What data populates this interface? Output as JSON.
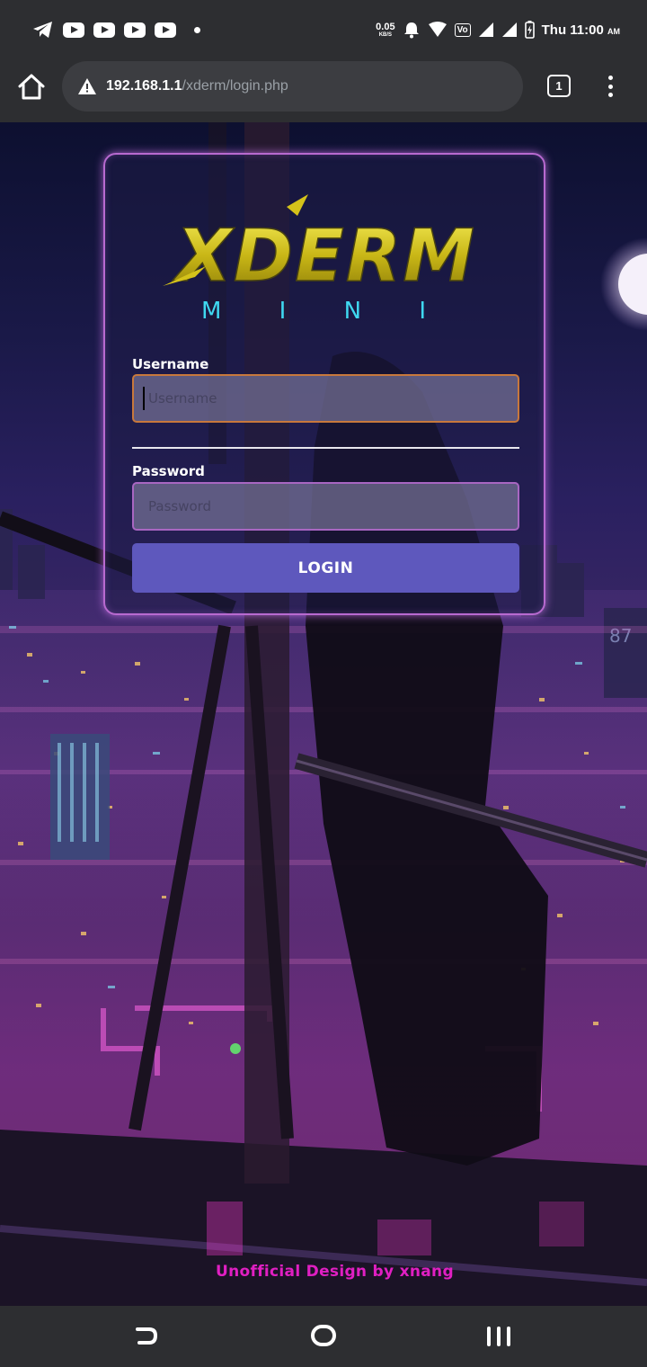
{
  "status_bar": {
    "net_speed_value": "0.05",
    "net_speed_unit": "KB/S",
    "volte_badge": "Vo",
    "time": "Thu 11:00",
    "ampm": "AM",
    "icons": [
      "telegram-icon",
      "youtube-icon",
      "youtube-icon",
      "youtube-icon",
      "youtube-icon",
      "notification-dot-icon",
      "alarm-icon",
      "wifi-icon",
      "signal-icon",
      "signal-icon",
      "battery-icon"
    ]
  },
  "browser": {
    "url_host": "192.168.1.1",
    "url_path": "/xderm/login.php",
    "tab_count": "1",
    "icons": [
      "home-icon",
      "warning-icon",
      "tab-switcher-icon",
      "overflow-menu-icon"
    ]
  },
  "login": {
    "logo_title": "XDERM",
    "logo_subtitle": "M I N I",
    "username_label": "Username",
    "username_placeholder": "Username",
    "username_value": "",
    "password_label": "Password",
    "password_placeholder": "Password",
    "password_value": "",
    "login_button": "LOGIN",
    "colors": {
      "logo_gold": "#d4c21a",
      "logo_cyan": "#3fd8f0",
      "button": "#5e58bd",
      "card_glow": "#c87be0"
    }
  },
  "footer": {
    "credit": "Unofficial Design by xnang",
    "color": "#e01fc2"
  },
  "nav_bar": {
    "icons": [
      "back-icon",
      "home-circle-icon",
      "recent-apps-icon"
    ]
  }
}
